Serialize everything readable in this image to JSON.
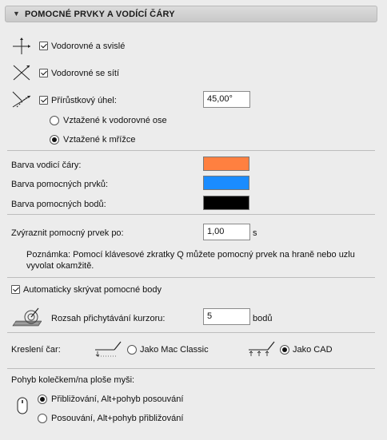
{
  "panel": {
    "title": "POMOCNÉ PRVKY A VODÍCÍ ČÁRY"
  },
  "guides": {
    "horizontal_vertical": {
      "label": "Vodorovné a svislé",
      "checked": true
    },
    "horizontal_grid": {
      "label": "Vodorovné se sítí",
      "checked": true
    },
    "increment_angle": {
      "label": "Přírůstkový úhel:",
      "checked": true,
      "value": "45,00°"
    },
    "angle_reference": {
      "options": [
        {
          "label": "Vztažené k vodorovné ose",
          "selected": false
        },
        {
          "label": "Vztažené k mřížce",
          "selected": true
        }
      ]
    }
  },
  "colors": {
    "guide_line": {
      "label": "Barva vodicí čáry:",
      "color": "#ff8040"
    },
    "helper_element": {
      "label": "Barva pomocných prvků:",
      "color": "#1a8cff"
    },
    "helper_point": {
      "label": "Barva pomocných bodů:",
      "color": "#000000"
    }
  },
  "highlight": {
    "label": "Zvýraznit pomocný prvek po:",
    "value": "1,00",
    "unit": "s",
    "note_line1": "Poznámka: Pomocí klávesové zkratky Q můžete pomocný prvek na hraně nebo uzlu",
    "note_line2": "vyvolat okamžitě."
  },
  "auto_hide": {
    "label": "Automaticky skrývat pomocné body",
    "checked": true
  },
  "snap": {
    "label": "Rozsah přichytávání kurzoru:",
    "value": "5",
    "unit": "bodů"
  },
  "line_drawing": {
    "label": "Kreslení čar:",
    "options": [
      {
        "label": "Jako Mac Classic",
        "selected": false
      },
      {
        "label": "Jako CAD",
        "selected": true
      }
    ]
  },
  "wheel": {
    "label": "Pohyb kolečkem/na ploše myši:",
    "options": [
      {
        "label": "Přibližování, Alt+pohyb posouvání",
        "selected": true
      },
      {
        "label": "Posouvání, Alt+pohyb přibližování",
        "selected": false
      }
    ]
  }
}
